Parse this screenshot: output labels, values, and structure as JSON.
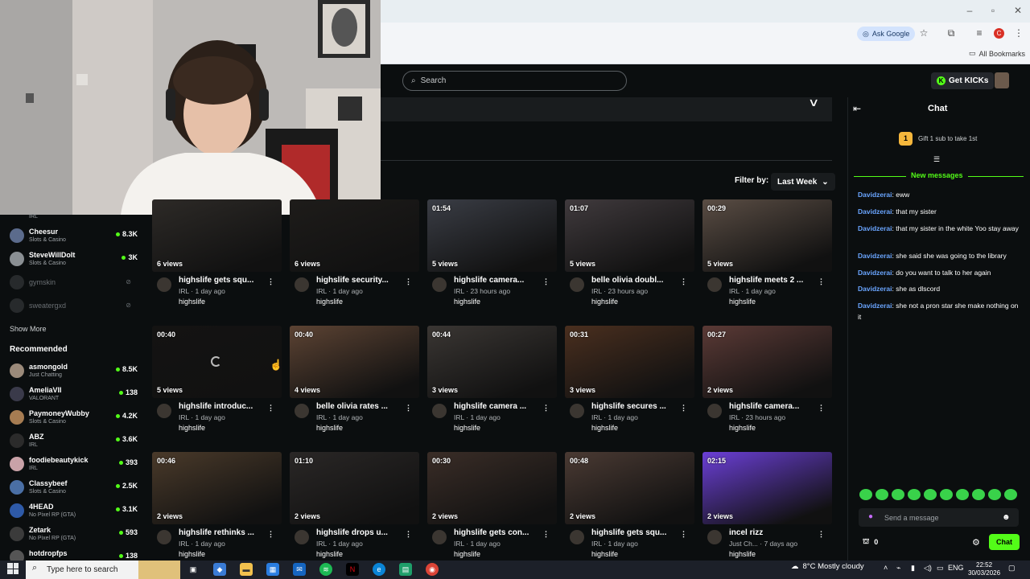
{
  "browser": {
    "ask_google": "Ask Google",
    "all_bookmarks": "All Bookmarks",
    "profile_initial": "C"
  },
  "header": {
    "search_placeholder": "Search",
    "get_kicks": "Get KICKs"
  },
  "filter": {
    "label": "Filter by:",
    "value": "Last Week"
  },
  "sidebar": {
    "partial_top_sub": "IRL",
    "following": [
      {
        "name": "Cheesur",
        "category": "Slots & Casino",
        "viewers": "8.3K",
        "avatar_color": "#5b6b8c"
      },
      {
        "name": "SteveWillDoIt",
        "category": "Slots & Casino",
        "viewers": "3K",
        "avatar_color": "#8a8f93"
      }
    ],
    "offline": [
      {
        "name": "gymskin"
      },
      {
        "name": "sweatergxd"
      }
    ],
    "show_more": "Show More",
    "recommended_title": "Recommended",
    "recommended": [
      {
        "name": "asmongold",
        "category": "Just Chatting",
        "viewers": "8.5K",
        "avatar_color": "#9b8a7a"
      },
      {
        "name": "AmeliaVII",
        "category": "VALORANT",
        "viewers": "138",
        "avatar_color": "#3a3a4a"
      },
      {
        "name": "PaymoneyWubby",
        "category": "Slots & Casino",
        "viewers": "4.2K",
        "avatar_color": "#a67c52"
      },
      {
        "name": "ABZ",
        "category": "IRL",
        "viewers": "3.6K",
        "avatar_color": "#2b2b2b"
      },
      {
        "name": "foodiebeautykick",
        "category": "IRL",
        "viewers": "393",
        "avatar_color": "#c9a2a8"
      },
      {
        "name": "Classybeef",
        "category": "Slots & Casino",
        "viewers": "2.5K",
        "avatar_color": "#4a6fa5"
      },
      {
        "name": "4HEAD",
        "category": "No Pixel RP (GTA)",
        "viewers": "3.1K",
        "avatar_color": "#2e5aa8"
      },
      {
        "name": "Zetark",
        "category": "No Pixel RP (GTA)",
        "viewers": "593",
        "avatar_color": "#3b3b3b"
      },
      {
        "name": "hotdropfps",
        "category": "",
        "viewers": "138",
        "avatar_color": "#555"
      }
    ]
  },
  "videos": [
    {
      "duration": "",
      "views": "6 views",
      "title": "highslife gets squ...",
      "meta": "IRL · 1 day ago",
      "channel": "highslife",
      "color": "#2d2a27"
    },
    {
      "duration": "",
      "views": "6 views",
      "title": "highslife security...",
      "meta": "IRL · 1 day ago",
      "channel": "highslife",
      "color": "#1e1c1a"
    },
    {
      "duration": "01:54",
      "views": "5 views",
      "title": "highslife camera...",
      "meta": "IRL · 23 hours ago",
      "channel": "highslife",
      "color": "#3a3d45"
    },
    {
      "duration": "01:07",
      "views": "5 views",
      "title": "belle olivia doubl...",
      "meta": "IRL · 23 hours ago",
      "channel": "highslife",
      "color": "#403a3d"
    },
    {
      "duration": "00:29",
      "views": "5 views",
      "title": "highslife meets 2 ...",
      "meta": "IRL · 1 day ago",
      "channel": "highslife",
      "color": "#5a4d44"
    },
    {
      "duration": "00:40",
      "views": "5 views",
      "title": "highslife introduc...",
      "meta": "IRL · 1 day ago",
      "channel": "highslife",
      "color": "#141312"
    },
    {
      "duration": "00:40",
      "views": "4 views",
      "title": "belle olivia rates ...",
      "meta": "IRL · 1 day ago",
      "channel": "highslife",
      "color": "#5c4333"
    },
    {
      "duration": "00:44",
      "views": "3 views",
      "title": "highslife camera ...",
      "meta": "IRL · 1 day ago",
      "channel": "highslife",
      "color": "#3a3633"
    },
    {
      "duration": "00:31",
      "views": "3 views",
      "title": "highslife secures ...",
      "meta": "IRL · 1 day ago",
      "channel": "highslife",
      "color": "#4a2f1f"
    },
    {
      "duration": "00:27",
      "views": "2 views",
      "title": "highslife camera...",
      "meta": "IRL · 23 hours ago",
      "channel": "highslife",
      "color": "#5b3a36"
    },
    {
      "duration": "00:46",
      "views": "2 views",
      "title": "highslife rethinks ...",
      "meta": "IRL · 1 day ago",
      "channel": "highslife",
      "color": "#4a3a2a"
    },
    {
      "duration": "01:10",
      "views": "2 views",
      "title": "highslife drops u...",
      "meta": "IRL · 1 day ago",
      "channel": "highslife",
      "color": "#2a2726"
    },
    {
      "duration": "00:30",
      "views": "2 views",
      "title": "highslife gets con...",
      "meta": "IRL · 1 day ago",
      "channel": "highslife",
      "color": "#3a2d27"
    },
    {
      "duration": "00:48",
      "views": "2 views",
      "title": "highslife gets squ...",
      "meta": "IRL · 1 day ago",
      "channel": "highslife",
      "color": "#4a3a33"
    },
    {
      "duration": "02:15",
      "views": "2 views",
      "title": "incel rizz",
      "meta": "Just Ch... · 7 days ago",
      "channel": "highslife",
      "color": "#6b3fd6"
    }
  ],
  "chat": {
    "title": "Chat",
    "gift_count": "1",
    "gift_text": "Gift 1 sub to take 1st",
    "new_messages": "New messages",
    "messages": [
      {
        "user": "Davidzerai",
        "text": ": eww"
      },
      {
        "user": "Davidzerai",
        "text": ": that my sister"
      },
      {
        "user": "Davidzerai",
        "text": ": that my sister in the white Yoo stay away"
      },
      {
        "user": "Davidzerai",
        "text": ": she said she was going to the library"
      },
      {
        "user": "Davidzerai",
        "text": ": do you want to talk to her again"
      },
      {
        "user": "Davidzerai",
        "text": ": she as dlscord"
      },
      {
        "user": "Davidzerai",
        "text": ": she not a pron star she make nothing on it"
      }
    ],
    "send_placeholder": "Send a message",
    "points": "0",
    "chat_button": "Chat"
  },
  "taskbar": {
    "search_placeholder": "Type here to search",
    "weather": "8°C  Mostly cloudy",
    "language": "ENG",
    "time": "22:52",
    "date": "30/03/2026"
  }
}
